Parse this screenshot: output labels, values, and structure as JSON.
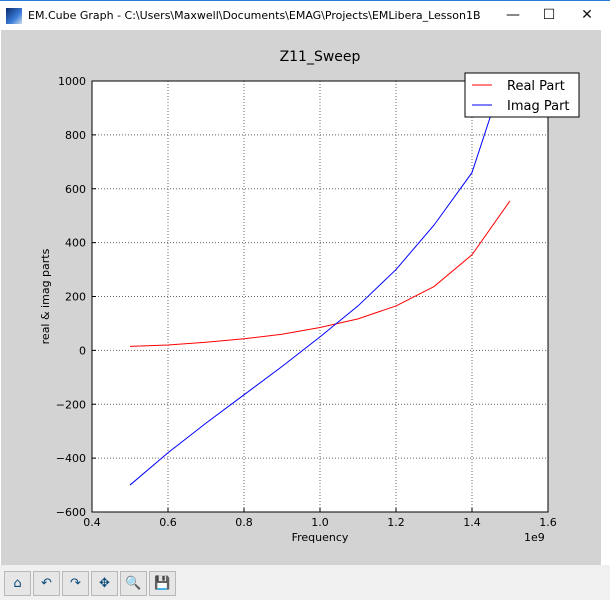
{
  "window": {
    "title": "EM.Cube Graph - C:\\Users\\Maxwell\\Documents\\EMAG\\Projects\\EMLibera_Lesson1B",
    "minimize": "—",
    "maximize": "☐",
    "close": "✕"
  },
  "toolbar": [
    {
      "icon": "home-icon",
      "glyph": "⌂"
    },
    {
      "icon": "back-icon",
      "glyph": "↶"
    },
    {
      "icon": "forward-icon",
      "glyph": "↷"
    },
    {
      "icon": "pan-icon",
      "glyph": "✥"
    },
    {
      "icon": "zoom-icon",
      "glyph": "🔍"
    },
    {
      "icon": "save-icon",
      "glyph": "💾"
    }
  ],
  "chart_data": {
    "type": "line",
    "title": "Z11_Sweep",
    "xlabel": "Frequency",
    "ylabel": "real & imag parts",
    "x_offset_label": "1e9",
    "xlim": [
      0.4,
      1.6
    ],
    "ylim": [
      -600,
      1000
    ],
    "xticks": [
      "0.4",
      "0.6",
      "0.8",
      "1.0",
      "1.2",
      "1.4",
      "1.6"
    ],
    "yticks": [
      "−600",
      "−400",
      "−200",
      "0",
      "200",
      "400",
      "600",
      "800",
      "1000"
    ],
    "grid": true,
    "legend_position": "top-right",
    "x": [
      0.5,
      0.6,
      0.7,
      0.8,
      0.9,
      1.0,
      1.1,
      1.2,
      1.3,
      1.4,
      1.5
    ],
    "series": [
      {
        "name": "Real Part",
        "color": "#ff0000",
        "values": [
          15,
          20,
          30,
          43,
          60,
          85,
          117,
          165,
          237,
          355,
          555
        ]
      },
      {
        "name": "Imag Part",
        "color": "#0000ff",
        "values": [
          -500,
          -380,
          -270,
          -165,
          -60,
          50,
          165,
          300,
          465,
          660,
          1090
        ]
      }
    ]
  }
}
